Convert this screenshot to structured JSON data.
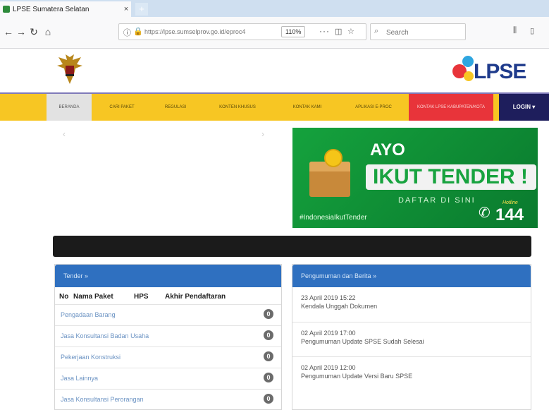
{
  "browser": {
    "tab_title": "LPSE Sumatera Selatan",
    "tab_close": "×",
    "new_tab": "+",
    "url": "https://lpse.sumselprov.go.id/eproc4",
    "zoom": "110%",
    "search_placeholder": "Search"
  },
  "site": {
    "logo_text": "LPSE"
  },
  "menu": {
    "items": [
      "BERANDA",
      "CARI PAKET",
      "REGULASI",
      "KONTEN KHUSUS",
      "KONTAK KAMI",
      "APLIKASI E-PROC",
      "KONTAK LPSE KABUPATEN/KOTA"
    ],
    "login": "LOGIN ▾"
  },
  "banner": {
    "line1": "AYO",
    "line2": "IKUT TENDER !",
    "line3": "DAFTAR DI SINI",
    "hashtag": "#IndonesiaIkutTender",
    "hotline_label": "Hotline",
    "hotline_number": "144"
  },
  "left_panel": {
    "title": "Tender »",
    "columns": [
      "No",
      "Nama Paket",
      "HPS",
      "Akhir Pendaftaran"
    ],
    "rows": [
      {
        "label": "Pengadaan Barang",
        "count": "0"
      },
      {
        "label": "Jasa Konsultansi Badan Usaha",
        "count": "0"
      },
      {
        "label": "Pekerjaan Konstruksi",
        "count": "0"
      },
      {
        "label": "Jasa Lainnya",
        "count": "0"
      },
      {
        "label": "Jasa Konsultansi Perorangan",
        "count": "0"
      }
    ]
  },
  "right_panel": {
    "title": "Pengumuman dan Berita »",
    "items": [
      {
        "date": "23 April 2019 15:22",
        "text": "Kendala Unggah Dokumen"
      },
      {
        "date": "02 April 2019 17:00",
        "text": "Pengumuman Update SPSE Sudah Selesai"
      },
      {
        "date": "02 April 2019 12:00",
        "text": "Pengumuman Update Versi Baru SPSE"
      }
    ]
  }
}
